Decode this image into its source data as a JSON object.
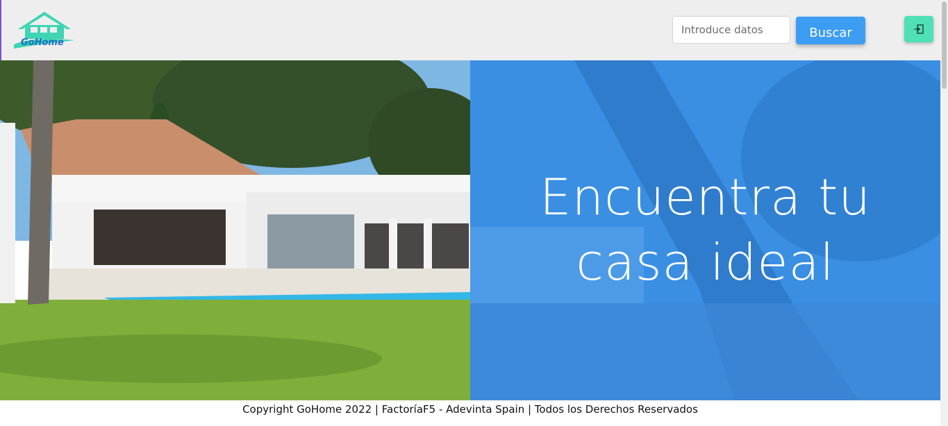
{
  "header": {
    "logo_text": "GoHome",
    "search_placeholder": "Introduce datos",
    "search_button_label": "Buscar",
    "login_icon": "login-icon"
  },
  "hero": {
    "title_line1": "Encuentra tu",
    "title_line2": "casa ideal"
  },
  "footer": {
    "copyright": "Copyright GoHome 2022 | FactoríaF5 - Adevinta Spain | Todos los Derechos Reservados"
  },
  "colors": {
    "header_bg": "#eeeeee",
    "accent_blue": "#3d9df2",
    "panel_blue": "#3a8fe3",
    "login_green": "#4fe0b6",
    "logo_teal": "#3fd4b4"
  }
}
